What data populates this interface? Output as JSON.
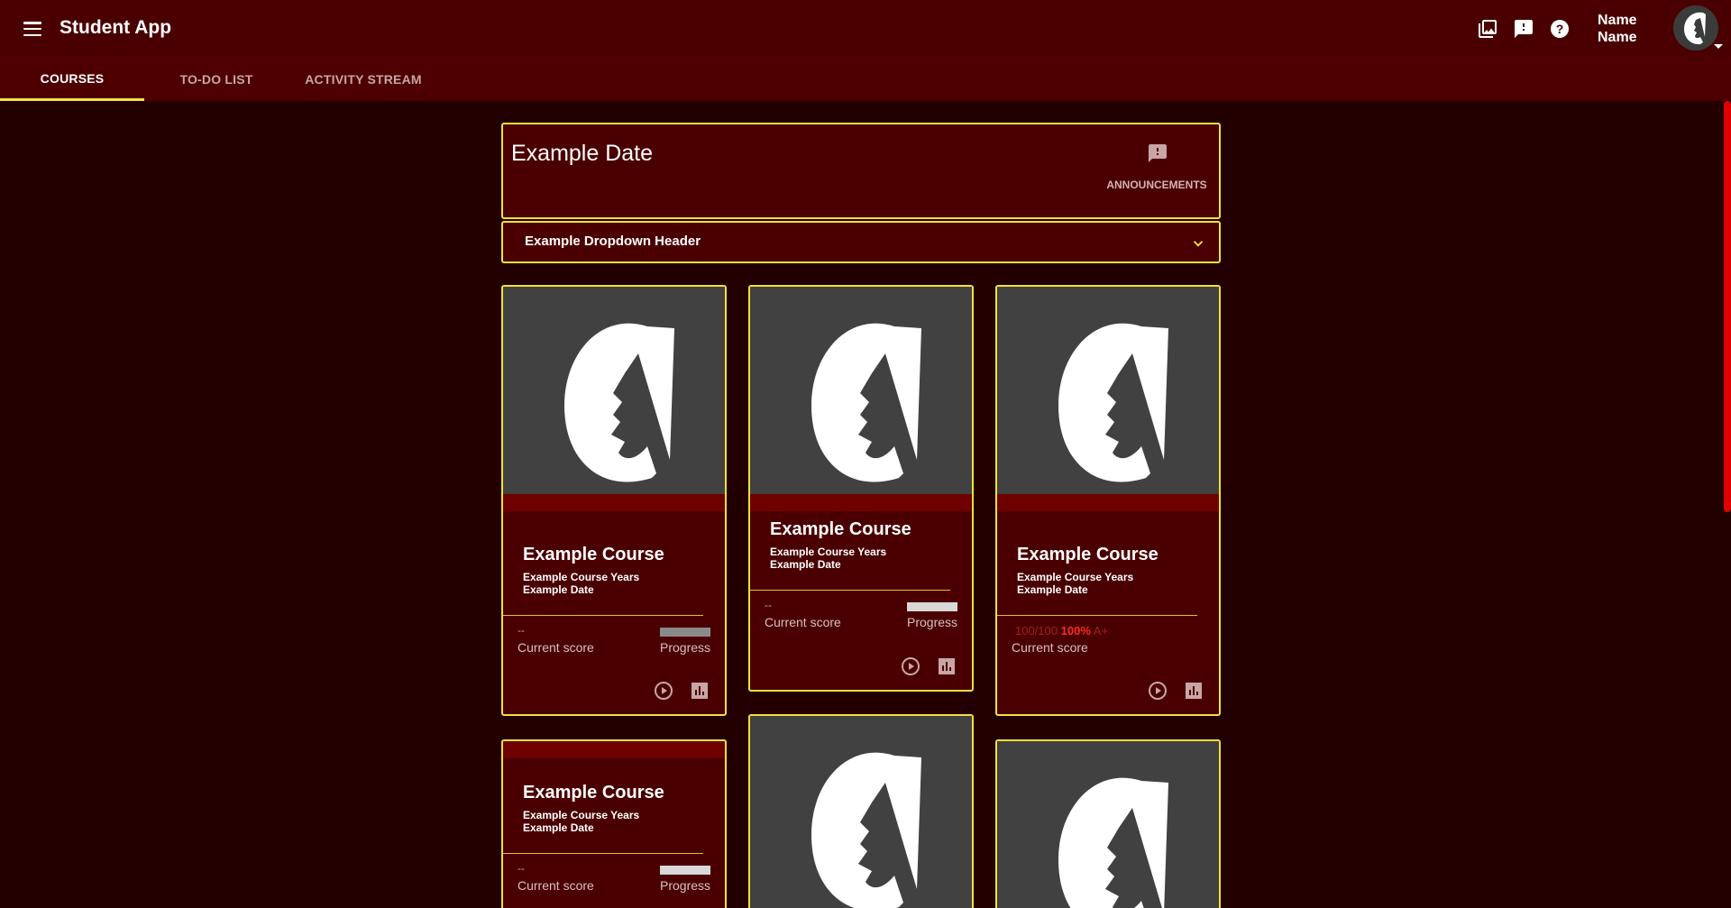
{
  "app": {
    "title": "Student App",
    "user_name": "Name Name"
  },
  "colors": {
    "appbar": "#4a0000",
    "background": "#220000",
    "accent": "#f2e03a",
    "card": "#4a0000",
    "image_bg": "#414141"
  },
  "top_icons": [
    "gallery-icon",
    "feedback-icon",
    "help-icon"
  ],
  "tabs": [
    {
      "label": "COURSES",
      "active": true
    },
    {
      "label": "TO-DO LIST",
      "active": false
    },
    {
      "label": "ACTIVITY STREAM",
      "active": false
    }
  ],
  "header": {
    "date": "Example Date",
    "announcements_label": "ANNOUNCEMENTS"
  },
  "dropdown": {
    "label": "Example Dropdown Header"
  },
  "courses": [
    {
      "title": "Example Course",
      "years": "Example Course Years",
      "date": "Example Date",
      "score_value": "--",
      "score_label": "Current score",
      "progress_label": "Progress"
    },
    {
      "title": "Example Course",
      "years": "Example Course Years",
      "date": "Example Date",
      "score_value": "--",
      "score_label": "Current score",
      "progress_label": "Progress"
    },
    {
      "title": "Example Course",
      "years": "Example Course Years",
      "date": "Example Date",
      "score_points": "100/100",
      "score_percent": "100%",
      "score_grade": "A+",
      "score_label": "Current score"
    },
    {
      "title": "Example Course",
      "years": "Example Course Years",
      "date": "Example Date",
      "score_value": "--",
      "score_label": "Current score",
      "progress_label": "Progress"
    }
  ]
}
